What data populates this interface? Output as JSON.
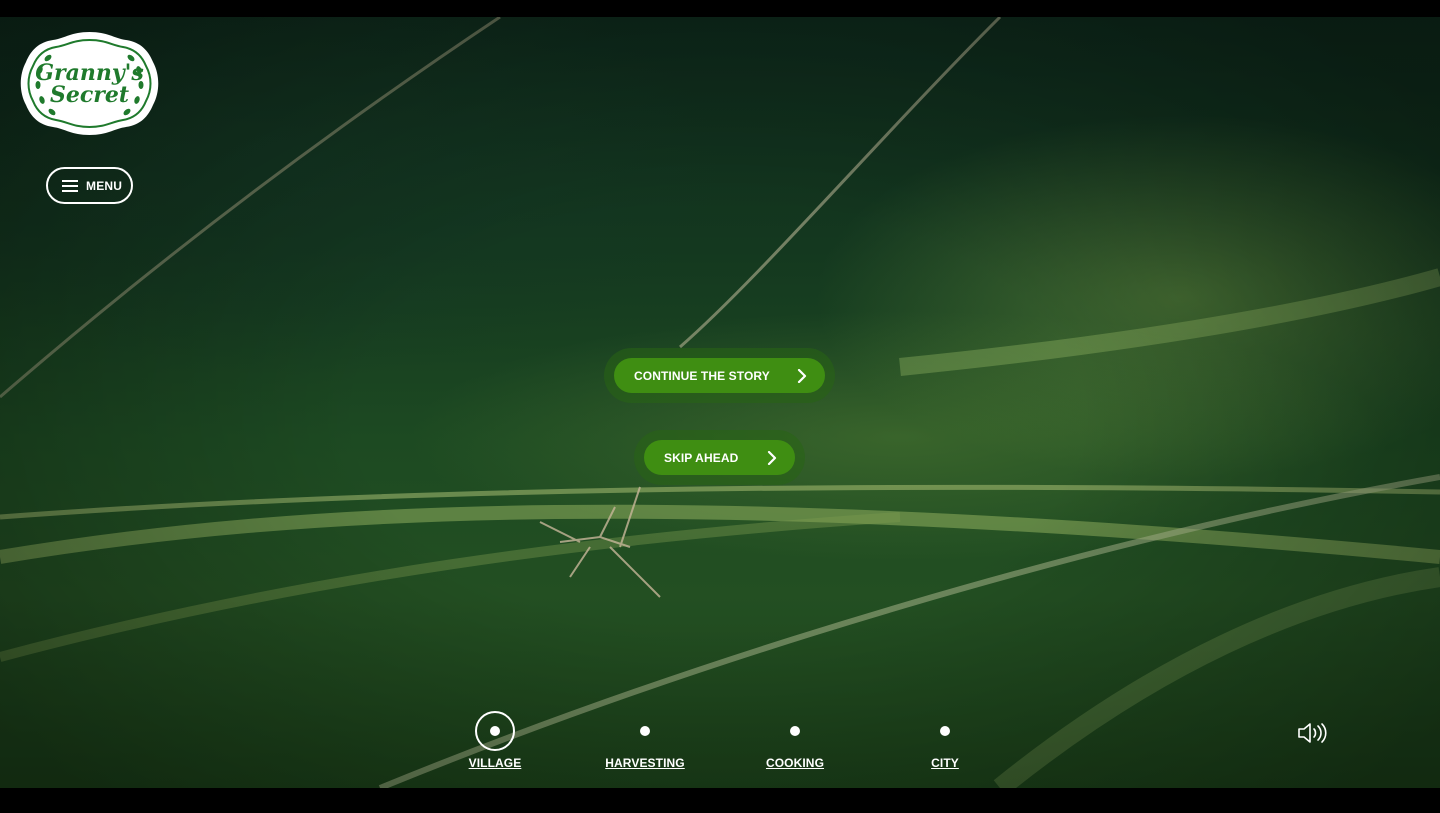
{
  "brand": {
    "logo_line1": "Granny's",
    "logo_line2": "Secret",
    "logo_color": "#1f7a2c"
  },
  "nav": {
    "menu_label": "MENU",
    "menu_icon": "hamburger-icon"
  },
  "actions": {
    "continue_label": "CONTINUE THE STORY",
    "skip_label": "SKIP AHEAD",
    "button_color": "#3f8e12",
    "chevron_icon": "chevron-right-icon"
  },
  "chapters": [
    {
      "label": "VILLAGE",
      "active": true
    },
    {
      "label": "HARVESTING",
      "active": false
    },
    {
      "label": "COOKING",
      "active": false
    },
    {
      "label": "CITY",
      "active": false
    }
  ],
  "audio": {
    "icon": "speaker-volume-icon"
  }
}
